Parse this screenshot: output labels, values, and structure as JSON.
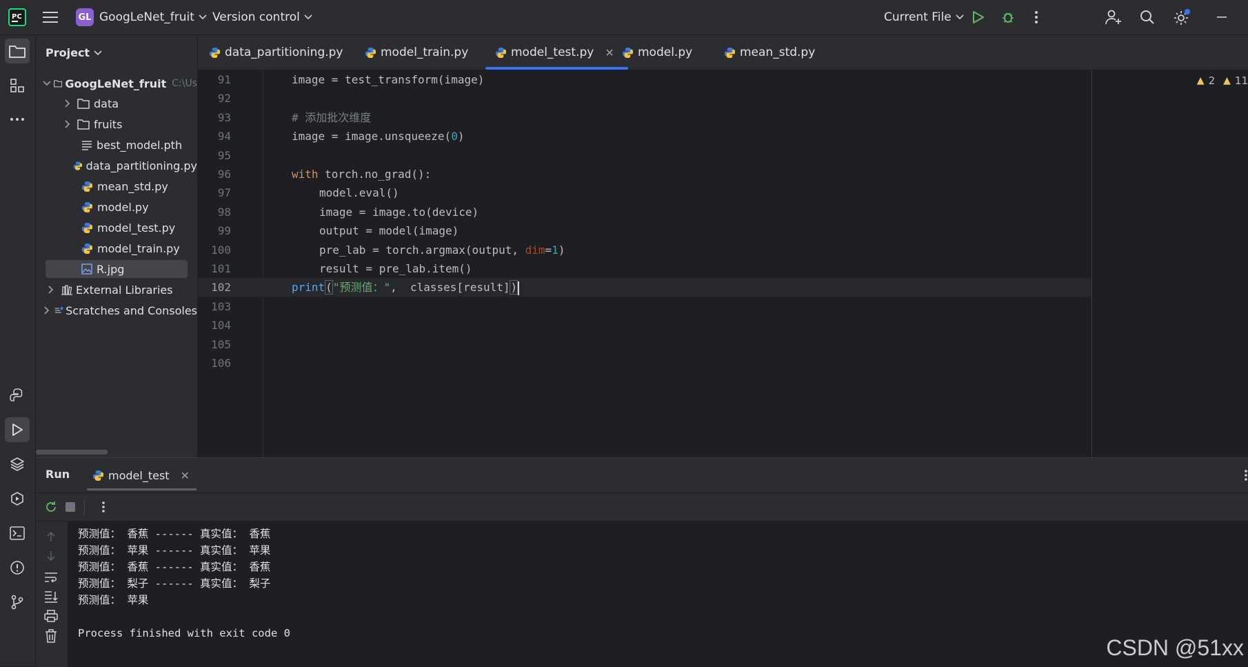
{
  "titlebar": {
    "project_badge": "GL",
    "project_name": "GoogLeNet_fruit",
    "vcs": "Version control",
    "run_config": "Current File"
  },
  "project_panel": {
    "title": "Project",
    "root": {
      "name": "GoogLeNet_fruit",
      "path_hint": "C:\\Us"
    },
    "items": [
      {
        "name": "data",
        "type": "folder"
      },
      {
        "name": "fruits",
        "type": "folder"
      },
      {
        "name": "best_model.pth",
        "type": "text-file"
      },
      {
        "name": "data_partitioning.py",
        "type": "python-file"
      },
      {
        "name": "mean_std.py",
        "type": "python-file"
      },
      {
        "name": "model.py",
        "type": "python-file"
      },
      {
        "name": "model_test.py",
        "type": "python-file"
      },
      {
        "name": "model_train.py",
        "type": "python-file"
      },
      {
        "name": "R.jpg",
        "type": "image-file",
        "selected": true
      }
    ],
    "external_libraries": "External Libraries",
    "scratches": "Scratches and Consoles"
  },
  "tabs": [
    {
      "label": "data_partitioning.py",
      "active": false
    },
    {
      "label": "model_train.py",
      "active": false
    },
    {
      "label": "model_test.py",
      "active": true
    },
    {
      "label": "model.py",
      "active": false
    },
    {
      "label": "mean_std.py",
      "active": false
    }
  ],
  "inspections": {
    "warnings": "2",
    "weak_warnings": "11"
  },
  "editor": {
    "current_line": 102,
    "lines": [
      {
        "n": "91",
        "parts": [
          [
            "",
            "image = test_transform(image)"
          ]
        ]
      },
      {
        "n": "92",
        "parts": []
      },
      {
        "n": "93",
        "parts": [
          [
            "cmt",
            "# 添加批次维度"
          ]
        ]
      },
      {
        "n": "94",
        "parts": [
          [
            "",
            "image = image.unsqueeze("
          ],
          [
            "num",
            "0"
          ],
          [
            "",
            ")"
          ]
        ]
      },
      {
        "n": "95",
        "parts": []
      },
      {
        "n": "96",
        "parts": [
          [
            "kw",
            "with"
          ],
          [
            "",
            " torch.no_grad():"
          ]
        ]
      },
      {
        "n": "97",
        "indent": true,
        "parts": [
          [
            "",
            "model.eval()"
          ]
        ]
      },
      {
        "n": "98",
        "indent": true,
        "parts": [
          [
            "",
            "image = image.to(device)"
          ]
        ]
      },
      {
        "n": "99",
        "indent": true,
        "parts": [
          [
            "",
            "output = model(image)"
          ]
        ]
      },
      {
        "n": "100",
        "indent": true,
        "parts": [
          [
            "",
            "pre_lab = torch.argmax(output, "
          ],
          [
            "param",
            "dim"
          ],
          [
            "",
            "="
          ],
          [
            "num",
            "1"
          ],
          [
            "",
            ")"
          ]
        ]
      },
      {
        "n": "101",
        "indent": true,
        "parts": [
          [
            "",
            "result = pre_lab.item()"
          ]
        ]
      },
      {
        "n": "102",
        "parts": [
          [
            "fn",
            "print"
          ],
          [
            "paren",
            "("
          ],
          [
            "str",
            "\"预测值：\""
          ],
          [
            "",
            ",  classes[result]"
          ],
          [
            "paren",
            ")"
          ]
        ]
      },
      {
        "n": "103",
        "parts": []
      },
      {
        "n": "104",
        "parts": []
      },
      {
        "n": "105",
        "parts": []
      },
      {
        "n": "106",
        "parts": []
      }
    ]
  },
  "run_panel": {
    "title": "Run",
    "tab_label": "model_test",
    "output": [
      "预测值： 香蕉 ------ 真实值： 香蕉",
      "预测值： 苹果 ------ 真实值： 苹果",
      "预测值： 香蕉 ------ 真实值： 香蕉",
      "预测值： 梨子 ------ 真实值： 梨子",
      "预测值： 苹果",
      "",
      "Process finished with exit code 0"
    ]
  },
  "watermark": "CSDN @51xx",
  "colors": {
    "accent": "#3574f0",
    "run_green": "#5fb865",
    "warning": "#f2c55c",
    "badge": "#8a5fd1"
  }
}
